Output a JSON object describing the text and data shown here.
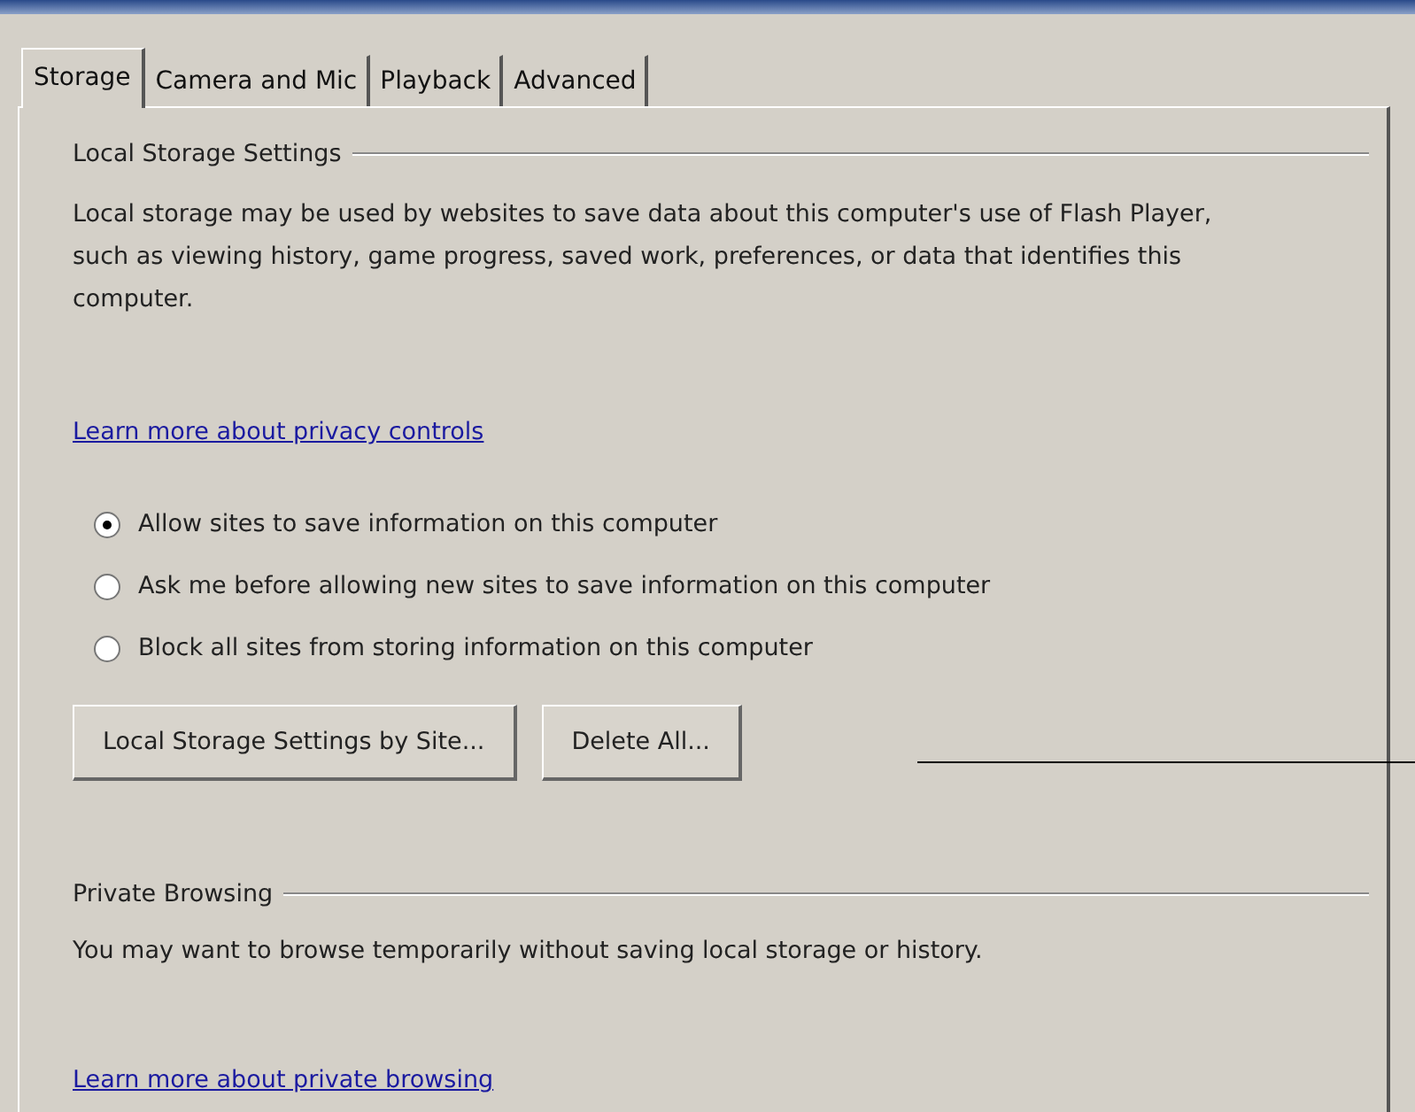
{
  "tabs": [
    {
      "label": "Storage",
      "selected": true
    },
    {
      "label": "Camera and Mic",
      "selected": false
    },
    {
      "label": "Playback",
      "selected": false
    },
    {
      "label": "Advanced",
      "selected": false
    }
  ],
  "local_storage": {
    "heading": "Local Storage Settings",
    "description": "Local storage may be used by websites to save data about this computer's use of Flash Player, such as viewing history, game progress, saved work, preferences, or data that identifies this computer.",
    "link": "Learn more about privacy controls",
    "options": [
      {
        "label": "Allow sites to save information on this computer",
        "selected": true
      },
      {
        "label": "Ask me before allowing new sites to save information on this computer",
        "selected": false
      },
      {
        "label": "Block all sites from storing information on this computer",
        "selected": false
      }
    ],
    "buttons": [
      "Local Storage Settings by Site...",
      "Delete All..."
    ]
  },
  "private_browsing": {
    "heading": "Private Browsing",
    "description": "You may want to browse temporarily without saving local storage or history.",
    "link": "Learn more about private browsing"
  }
}
